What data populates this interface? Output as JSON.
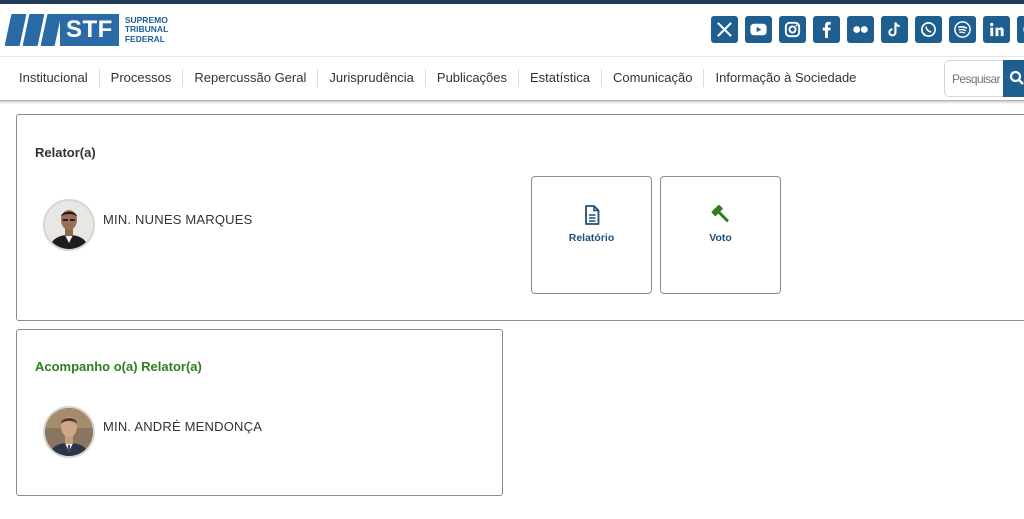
{
  "header": {
    "logo": {
      "abbrev": "STF",
      "line1": "SUPREMO",
      "line2": "TRIBUNAL",
      "line3": "FEDERAL"
    },
    "social_icons": [
      "x-icon",
      "youtube-icon",
      "instagram-icon",
      "facebook-icon",
      "flickr-icon",
      "tiktok-icon",
      "whatsapp-icon",
      "spotify-icon",
      "linkedin-icon",
      "extra-icon"
    ],
    "brand_color": "#1f5f8f"
  },
  "nav": {
    "items": [
      {
        "label": "Institucional"
      },
      {
        "label": "Processos"
      },
      {
        "label": "Repercussão Geral"
      },
      {
        "label": "Jurisprudência"
      },
      {
        "label": "Publicações"
      },
      {
        "label": "Estatística"
      },
      {
        "label": "Comunicação"
      },
      {
        "label": "Informação à Sociedade"
      }
    ],
    "search": {
      "placeholder": "Pesquisar"
    }
  },
  "relator_panel": {
    "title": "Relator(a)",
    "minister": "MIN. NUNES MARQUES",
    "buttons": [
      {
        "label": "Relatório",
        "icon": "document-icon"
      },
      {
        "label": "Voto",
        "icon": "gavel-icon"
      }
    ]
  },
  "vote_panel": {
    "title": "Acompanho o(a) Relator(a)",
    "title_color": "#2e7d1f",
    "minister": "MIN. ANDRÉ MENDONÇA"
  }
}
